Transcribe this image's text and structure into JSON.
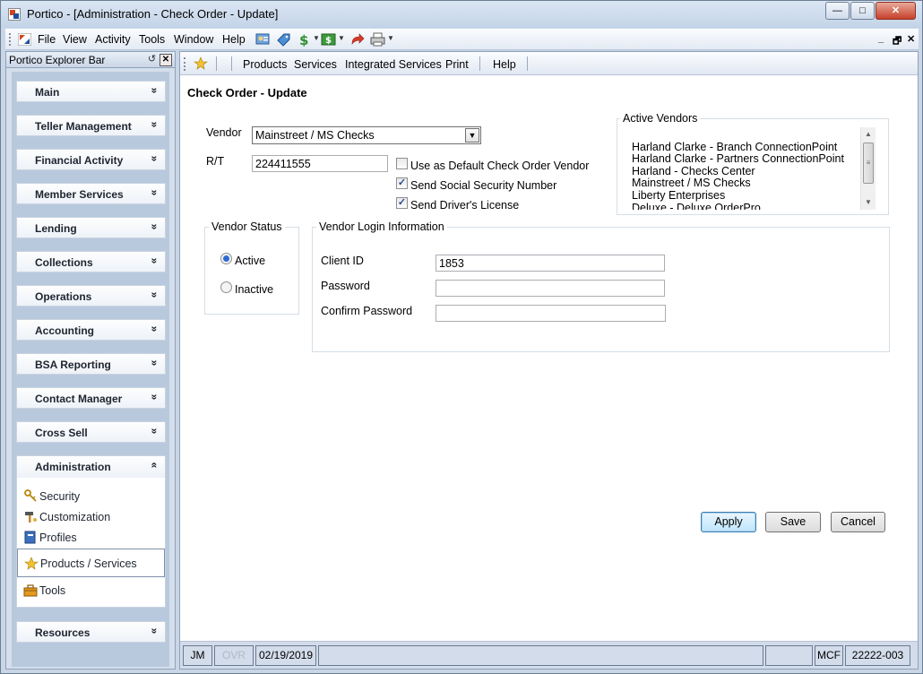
{
  "window": {
    "title": "Portico - [Administration - Check Order - Update]",
    "min": "—",
    "max": "□",
    "close": "✕"
  },
  "menu": {
    "items": [
      "File",
      "View",
      "Activity",
      "Tools",
      "Window",
      "Help"
    ],
    "mdi_min": "_",
    "mdi_restore": "🗗",
    "mdi_close": "✕"
  },
  "explorer": {
    "title": "Portico Explorer Bar",
    "pin": "↺",
    "close": "✕",
    "sections": [
      "Main",
      "Teller Management",
      "Financial Activity",
      "Member Services",
      "Lending",
      "Collections",
      "Operations",
      "Accounting",
      "BSA Reporting",
      "Contact Manager",
      "Cross Sell",
      "Administration",
      "Resources"
    ],
    "chevron_down": "»",
    "chevron_up": "«",
    "admin_items": [
      "Security",
      "Customization",
      "Profiles",
      "Products / Services",
      "Tools"
    ],
    "admin_selected": "Products / Services"
  },
  "subtoolbar": {
    "items": [
      "Products",
      "Services",
      "Integrated Services",
      "Print",
      "Help"
    ]
  },
  "form": {
    "page_title": "Check Order - Update",
    "vendor_label": "Vendor",
    "vendor_value": "Mainstreet / MS Checks",
    "rt_label": "R/T",
    "rt_value": "224411555",
    "default_vendor_label": "Use as Default Check Order Vendor",
    "default_vendor_checked": false,
    "send_ssn_label": "Send Social Security Number",
    "send_ssn_checked": true,
    "send_dl_label": "Send Driver's License",
    "send_dl_checked": true,
    "check_mark": "✓",
    "active_vendors_title": "Active Vendors",
    "active_vendors": [
      "Harland Clarke - Branch ConnectionPoint",
      "Harland Clarke - Partners ConnectionPoint",
      "Harland - Checks Center",
      "Mainstreet / MS Checks",
      "Liberty Enterprises",
      "Deluxe - Deluxe OrderPro"
    ],
    "vendor_status_title": "Vendor Status",
    "status_active": "Active",
    "status_inactive": "Inactive",
    "status_selected": "Active",
    "login_title": "Vendor Login Information",
    "client_id_label": "Client ID",
    "client_id_value": "1853",
    "password_label": "Password",
    "password_value": "",
    "confirm_password_label": "Confirm Password",
    "confirm_password_value": ""
  },
  "buttons": {
    "apply": "Apply",
    "save": "Save",
    "cancel": "Cancel"
  },
  "statusbar": {
    "user": "JM",
    "ovr": "OVR",
    "date": "02/19/2019",
    "mode": "MCF",
    "station": "22222-003"
  }
}
